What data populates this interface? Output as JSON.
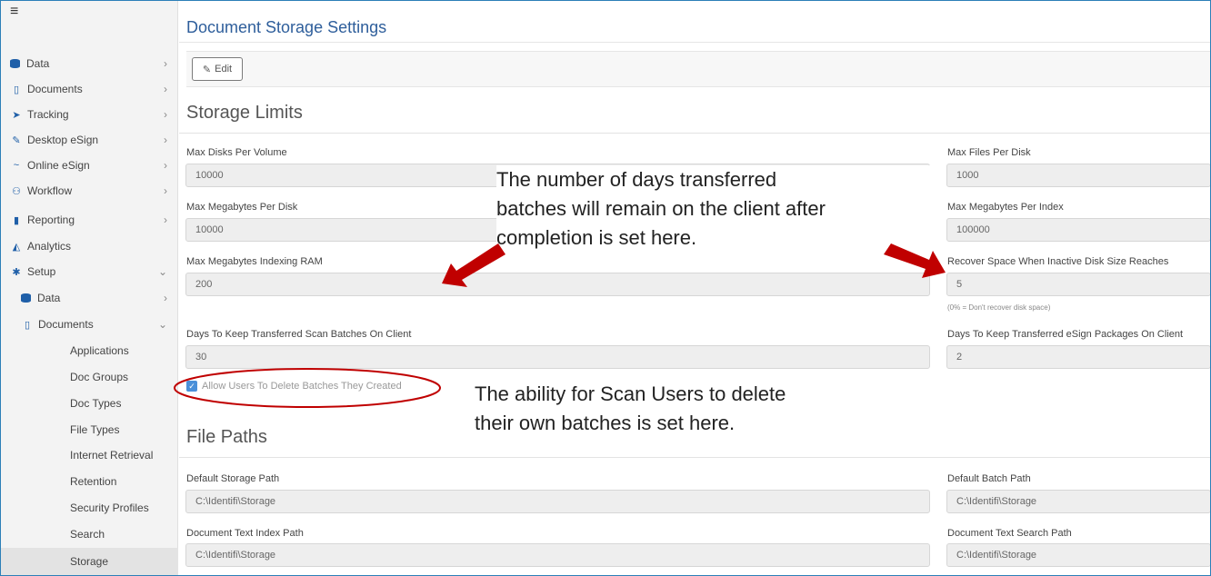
{
  "sidebar": {
    "menu_icon": "≡",
    "items": [
      {
        "label": "Data",
        "icon": "database-icon",
        "chevron": "›"
      },
      {
        "label": "Documents",
        "icon": "clipboard-icon",
        "chevron": "›"
      },
      {
        "label": "Tracking",
        "icon": "send-icon",
        "chevron": "›"
      },
      {
        "label": "Desktop eSign",
        "icon": "pen-icon",
        "chevron": "›"
      },
      {
        "label": "Online eSign",
        "icon": "signature-icon",
        "chevron": "›"
      },
      {
        "label": "Workflow",
        "icon": "sitemap-icon",
        "chevron": "›"
      },
      {
        "label": "Reporting",
        "icon": "file-icon",
        "chevron": "›"
      },
      {
        "label": "Analytics",
        "icon": "area-chart-icon",
        "chevron": ""
      },
      {
        "label": "Setup",
        "icon": "gear-icon",
        "chevron": "⌄"
      },
      {
        "label": "Data",
        "icon": "database-icon",
        "chevron": "›"
      },
      {
        "label": "Documents",
        "icon": "clipboard-icon",
        "chevron": "⌄"
      },
      {
        "label": "Applications"
      },
      {
        "label": "Doc Groups"
      },
      {
        "label": "Doc Types"
      },
      {
        "label": "File Types"
      },
      {
        "label": "Internet Retrieval"
      },
      {
        "label": "Retention"
      },
      {
        "label": "Security Profiles"
      },
      {
        "label": "Search"
      },
      {
        "label": "Storage"
      }
    ]
  },
  "page": {
    "title": "Document Storage Settings",
    "edit_label": "Edit"
  },
  "storage_limits": {
    "title": "Storage Limits",
    "max_disks_label": "Max Disks Per Volume",
    "max_disks_value": "10000",
    "max_files_label": "Max Files Per Disk",
    "max_files_value": "1000",
    "max_mb_disk_label": "Max Megabytes Per Disk",
    "max_mb_disk_value": "10000",
    "max_mb_index_label": "Max Megabytes Per Index",
    "max_mb_index_value": "100000",
    "max_mb_ram_label": "Max Megabytes Indexing RAM",
    "max_mb_ram_value": "200",
    "recover_label": "Recover Space When Inactive Disk Size Reaches",
    "recover_value": "5",
    "recover_hint": "(0% = Don't recover disk space)",
    "days_scan_label": "Days To Keep Transferred Scan Batches On Client",
    "days_scan_value": "30",
    "days_esign_label": "Days To Keep Transferred eSign Packages On Client",
    "days_esign_value": "2",
    "allow_delete_label": "Allow Users To Delete Batches They Created"
  },
  "file_paths": {
    "title": "File Paths",
    "default_storage_label": "Default Storage Path",
    "default_storage_value": "C:\\Identifi\\Storage",
    "default_batch_label": "Default Batch Path",
    "default_batch_value": "C:\\Identifi\\Storage",
    "text_index_label": "Document Text Index Path",
    "text_index_value": "C:\\Identifi\\Storage",
    "text_search_label": "Document Text Search Path",
    "text_search_value": "C:\\Identifi\\Storage"
  },
  "annotations": {
    "days_line1": "The number of days transferred",
    "days_line2": "batches will remain on the client after",
    "days_line3": "completion is set here.",
    "delete_line1": "The ability for Scan Users to delete",
    "delete_line2": "their own batches is set here.",
    "arrow_color": "#c00000"
  }
}
